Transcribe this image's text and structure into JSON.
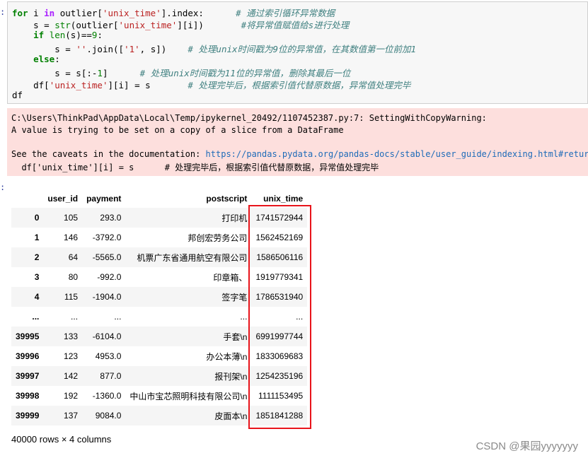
{
  "prompt_markers": [
    ":",
    ":"
  ],
  "code_lines": [
    [
      {
        "t": "for",
        "c": "kw"
      },
      {
        "t": " i ",
        "c": ""
      },
      {
        "t": "in",
        "c": "op"
      },
      {
        "t": " outlier[",
        "c": ""
      },
      {
        "t": "'unix_time'",
        "c": "str"
      },
      {
        "t": "].index:      ",
        "c": ""
      },
      {
        "t": "# 通过索引循环异常数据",
        "c": "cmt"
      }
    ],
    [
      {
        "t": "    s = ",
        "c": ""
      },
      {
        "t": "str",
        "c": "bi"
      },
      {
        "t": "(outlier[",
        "c": ""
      },
      {
        "t": "'unix_time'",
        "c": "str"
      },
      {
        "t": "][i])       ",
        "c": ""
      },
      {
        "t": "#将异常值赋值给s进行处理",
        "c": "cmt"
      }
    ],
    [
      {
        "t": "    ",
        "c": ""
      },
      {
        "t": "if",
        "c": "kw"
      },
      {
        "t": " ",
        "c": ""
      },
      {
        "t": "len",
        "c": "bi"
      },
      {
        "t": "(s)==",
        "c": ""
      },
      {
        "t": "9",
        "c": "num"
      },
      {
        "t": ":",
        "c": ""
      }
    ],
    [
      {
        "t": "        s = ",
        "c": ""
      },
      {
        "t": "''",
        "c": "str"
      },
      {
        "t": ".join([",
        "c": ""
      },
      {
        "t": "'1'",
        "c": "str"
      },
      {
        "t": ", s])    ",
        "c": ""
      },
      {
        "t": "# 处理unix时间戳为9位的异常值，在其数值第一位前加1",
        "c": "cmt"
      }
    ],
    [
      {
        "t": "    ",
        "c": ""
      },
      {
        "t": "else",
        "c": "kw"
      },
      {
        "t": ":",
        "c": ""
      }
    ],
    [
      {
        "t": "        s = s[:-",
        "c": ""
      },
      {
        "t": "1",
        "c": "num"
      },
      {
        "t": "]      ",
        "c": ""
      },
      {
        "t": "# 处理unix时间戳为11位的异常值，删除其最后一位",
        "c": "cmt"
      }
    ],
    [
      {
        "t": "    df[",
        "c": ""
      },
      {
        "t": "'unix_time'",
        "c": "str"
      },
      {
        "t": "][i] = s       ",
        "c": ""
      },
      {
        "t": "# 处理完毕后，根据索引值代替原数据，异常值处理完毕",
        "c": "cmt"
      }
    ],
    [
      {
        "t": "df",
        "c": ""
      }
    ]
  ],
  "warning": {
    "line1": "C:\\Users\\ThinkPad\\AppData\\Local\\Temp/ipykernel_20492/1107452387.py:7: SettingWithCopyWarning:",
    "line2": "A value is trying to be set on a copy of a slice from a DataFrame",
    "line3_prefix": "See the caveats in the documentation: ",
    "line3_link": "https://pandas.pydata.org/pandas-docs/stable/user_guide/indexing.html#returni",
    "line4": "  df['unix_time'][i] = s      # 处理完毕后，根据索引值代替原数据，异常值处理完毕"
  },
  "table": {
    "columns": [
      "",
      "user_id",
      "payment",
      "postscript",
      "unix_time"
    ],
    "rows": [
      [
        "0",
        "105",
        "293.0",
        "打印机",
        "1741572944"
      ],
      [
        "1",
        "146",
        "-3792.0",
        "邦创宏劳务公司",
        "1562452169"
      ],
      [
        "2",
        "64",
        "-5565.0",
        "机票广东省通用航空有限公司",
        "1586506116"
      ],
      [
        "3",
        "80",
        "-992.0",
        "印章箱、",
        "1919779341"
      ],
      [
        "4",
        "115",
        "-1904.0",
        "签字笔",
        "1786531940"
      ],
      [
        "...",
        "...",
        "...",
        "...",
        "..."
      ],
      [
        "39995",
        "133",
        "-6104.0",
        "手套\\n",
        "6991997744"
      ],
      [
        "39996",
        "123",
        "4953.0",
        "办公本薄\\n",
        "1833069683"
      ],
      [
        "39997",
        "142",
        "877.0",
        "报刊架\\n",
        "1254235196"
      ],
      [
        "39998",
        "192",
        "-1360.0",
        "中山市宝芯照明科技有限公司\\n",
        "1111153495"
      ],
      [
        "39999",
        "137",
        "9084.0",
        "皮面本\\n",
        "1851841288"
      ]
    ]
  },
  "shape_note": "40000 rows × 4 columns",
  "watermark": "CSDN @果园yyyyyyy",
  "colors": {
    "highlight": "#e8141b",
    "warning_bg": "#fddfdd"
  }
}
